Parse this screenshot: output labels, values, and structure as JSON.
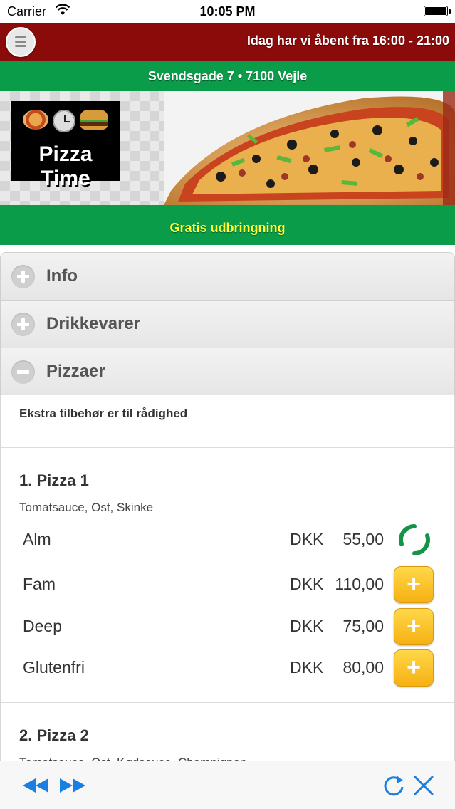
{
  "status_bar": {
    "carrier": "Carrier",
    "time": "10:05 PM",
    "wifi_icon": "wifi-icon",
    "battery_icon": "battery-icon"
  },
  "header": {
    "menu_icon": "hamburger-menu-icon",
    "hours": "Idag har vi åbent fra 16:00 - 21:00",
    "bg_color": "#8b0a0a"
  },
  "address": {
    "text": "Svendsgade 7 • 7100 Vejle",
    "bg_color": "#0b9c49"
  },
  "banner": {
    "logo_text": "Pizza Time",
    "logo_icons": [
      "pizza-icon",
      "clock-icon",
      "burger-icon"
    ]
  },
  "delivery": {
    "text": "Gratis udbringning",
    "text_color": "#ffff33"
  },
  "accordion": [
    {
      "label": "Info",
      "state": "collapsed",
      "icon": "plus-icon"
    },
    {
      "label": "Drikkevarer",
      "state": "collapsed",
      "icon": "plus-icon"
    },
    {
      "label": "Pizzaer",
      "state": "expanded",
      "icon": "minus-icon"
    }
  ],
  "menu": {
    "note": "Ekstra tilbehør er til rådighed",
    "items": [
      {
        "title": "1. Pizza 1",
        "description": "Tomatsauce, Ost, Skinke",
        "variants": [
          {
            "size": "Alm",
            "currency": "DKK",
            "price": "55,00",
            "action": "loading"
          },
          {
            "size": "Fam",
            "currency": "DKK",
            "price": "110,00",
            "action": "add"
          },
          {
            "size": "Deep",
            "currency": "DKK",
            "price": "75,00",
            "action": "add"
          },
          {
            "size": "Glutenfri",
            "currency": "DKK",
            "price": "80,00",
            "action": "add"
          }
        ]
      },
      {
        "title": "2. Pizza 2",
        "description": "Tomatsauce, Ost, Kødsauce, Champignon"
      }
    ],
    "add_symbol": "+",
    "accent_color": "#f6b012"
  },
  "toolbar": {
    "icons": [
      "rewind-icon",
      "fast-forward-icon",
      "refresh-icon",
      "close-icon"
    ],
    "color": "#1a7fe0"
  }
}
